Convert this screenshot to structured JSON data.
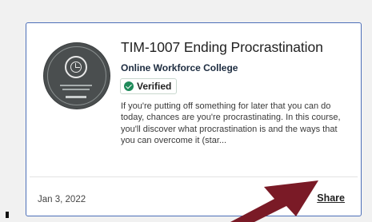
{
  "card": {
    "title": "TIM-1007 Ending Procrastination",
    "organization": "Online Workforce College",
    "verified_label": "Verified",
    "description": "If you're putting off something for later that you can do today, chances are you're procrastinating. In this course, you'll discover what procrastination is and the ways that you can overcome it (star...",
    "date": "Jan 3, 2022",
    "share_label": "Share"
  },
  "icons": {
    "badge": "time-management-badge-icon",
    "verified": "check-circle-icon",
    "arrow": "annotation-arrow"
  },
  "colors": {
    "card_border": "#4d6fb8",
    "verified_check": "#1e8a5a",
    "arrow": "#7a1a26"
  }
}
